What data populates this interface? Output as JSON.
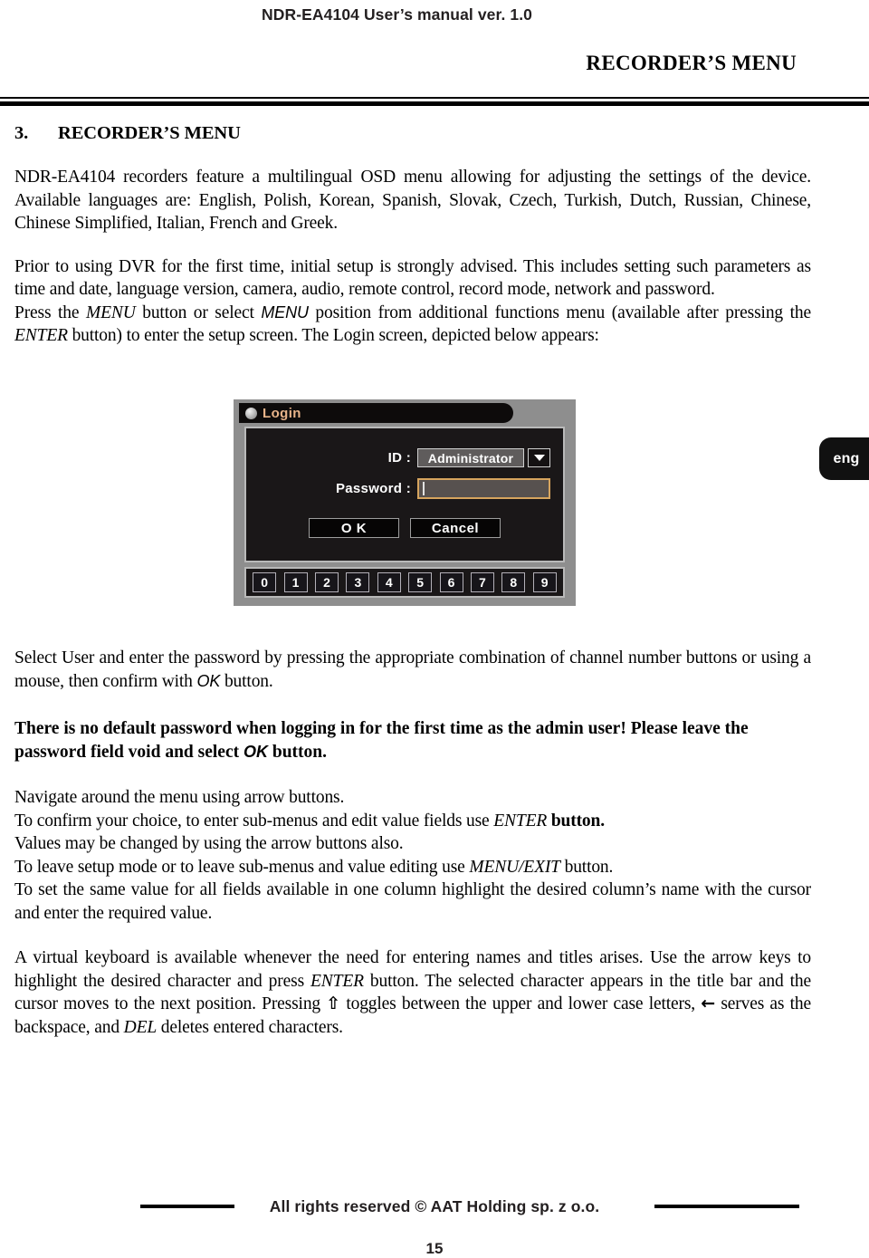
{
  "header": {
    "manual_title": "NDR-EA4104 User’s manual ver. 1.0",
    "section_title": "RECORDER’S MENU"
  },
  "section": {
    "number": "3.",
    "title": "RECORDER’S MENU"
  },
  "paragraphs": {
    "intro": "NDR-EA4104 recorders feature a multilingual OSD menu allowing for adjusting the settings of the device. Available languages are: English, Polish, Korean, Spanish, Slovak, Czech, Turkish, Dutch, Russian, Chinese, Chinese Simplified, Italian, French and Greek.",
    "setup_advice": "Prior to using DVR for the first time, initial setup is strongly advised. This includes setting such parameters as time and date, language version, camera, audio, remote control, record mode, network and password.",
    "press_menu_pre": "Press the ",
    "press_menu_italic1": "MENU",
    "press_menu_mid1": " button or select ",
    "press_menu_sans": "MENU",
    "press_menu_mid2": " position from additional functions menu (available after pressing the ",
    "press_menu_italic2": "ENTER",
    "press_menu_end": " button)  to enter the setup screen. The  Login screen, depicted below appears:",
    "select_user_pre": "Select User and enter the password by pressing the appropriate combination of channel number buttons or using a mouse, then confirm with ",
    "select_user_ok": "OK",
    "select_user_end": " button.",
    "note_pre": "There is no default password when logging in for the first time as the admin user! Please leave the password field void and select ",
    "note_ok": "OK",
    "note_end": " button.",
    "nav_line1": "Navigate around the menu using arrow buttons.",
    "nav_line2_pre": "To confirm your choice, to enter sub-menus and edit value fields use ",
    "nav_line2_italic": "ENTER",
    "nav_line2_end": " button.",
    "nav_line3": "Values may be changed by using the arrow buttons also.",
    "nav_line4_pre": "To leave setup mode or to leave sub-menus and value editing use ",
    "nav_line4_italic": "MENU/EXIT",
    "nav_line4_end": " button.",
    "nav_line5": "To set the same value for all fields available in one column highlight the desired column’s name with the cursor and enter the required value.",
    "keyboard_pre": "A virtual keyboard is available whenever the need for entering names and titles arises. Use the arrow keys to highlight the desired character and press ",
    "keyboard_italic1": "ENTER",
    "keyboard_mid1": " button. The selected character appears in the title bar and the cursor moves to the next position. Pressing ",
    "keyboard_glyph_shift": "⇧",
    "keyboard_mid2": " toggles between the upper and lower case letters, ",
    "keyboard_glyph_back": "←",
    "keyboard_mid3": " serves as the backspace, and ",
    "keyboard_italic2": "DEL",
    "keyboard_end": " deletes entered characters."
  },
  "login_dialog": {
    "title": "Login",
    "id_label": "ID :",
    "id_value": "Administrator",
    "password_label": "Password :",
    "password_value": "",
    "ok_label": "O K",
    "cancel_label": "Cancel",
    "numpad_keys": [
      "0",
      "1",
      "2",
      "3",
      "4",
      "5",
      "6",
      "7",
      "8",
      "9"
    ]
  },
  "lang_badge": {
    "label": "eng"
  },
  "footer": {
    "copyright": "All rights reserved © AAT Holding sp. z o.o.",
    "page_number": "15"
  }
}
